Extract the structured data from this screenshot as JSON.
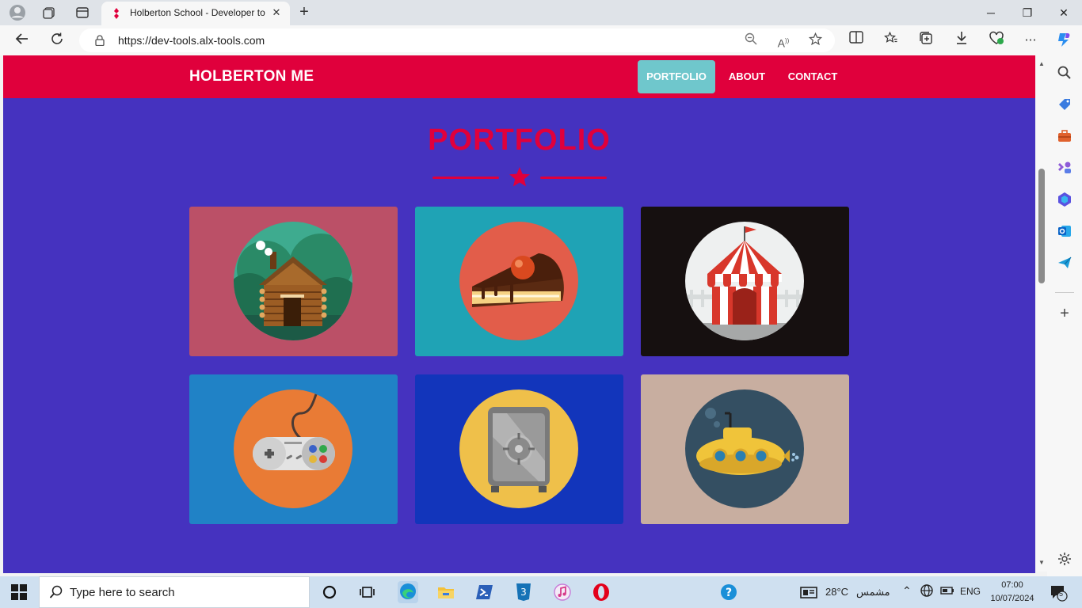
{
  "browser": {
    "tab_title": "Holberton School - Developer to",
    "url": "https://dev-tools.alx-tools.com"
  },
  "site": {
    "brand": "HOLBERTON ME",
    "nav": [
      {
        "label": "PORTFOLIO",
        "active": true
      },
      {
        "label": "ABOUT",
        "active": false
      },
      {
        "label": "CONTACT",
        "active": false
      }
    ],
    "section_title": "PORTFOLIO",
    "portfolio": [
      {
        "subject": "log-cabin",
        "bg": "#bb5067"
      },
      {
        "subject": "cake-slice",
        "bg": "#1fa3b5"
      },
      {
        "subject": "circus-tent",
        "bg": "#161010"
      },
      {
        "subject": "game-controller",
        "bg": "#2082c6"
      },
      {
        "subject": "safe",
        "bg": "#1235bb"
      },
      {
        "subject": "submarine",
        "bg": "#c8aea0"
      }
    ]
  },
  "colors": {
    "page_bg": "#4532bf",
    "header_bg": "#e0003c",
    "active_nav_bg": "#6fc7cc",
    "title": "#e0003c"
  },
  "taskbar": {
    "search_placeholder": "Type here to search",
    "temperature": "28°C",
    "weather": "مشمس",
    "language": "ENG",
    "time": "07:00",
    "date": "10/07/2024",
    "notifications": "5"
  }
}
